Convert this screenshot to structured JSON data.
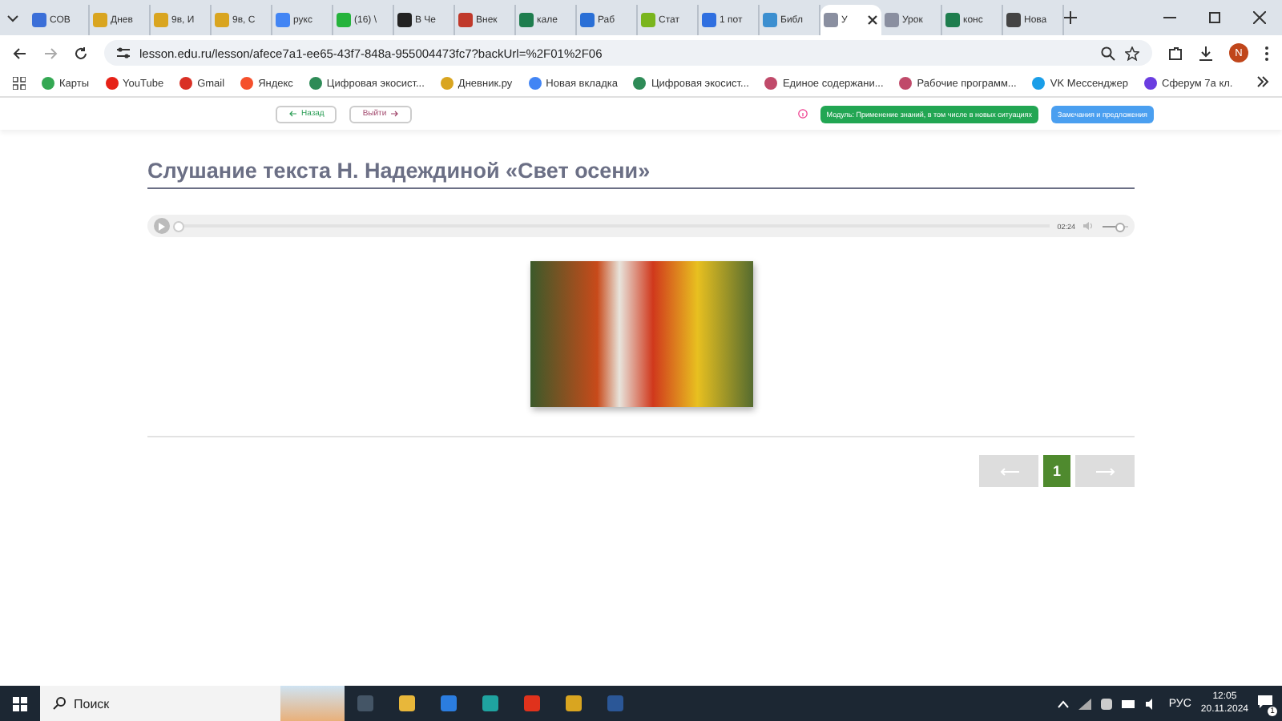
{
  "browser": {
    "tabs": [
      {
        "label": "СОВ",
        "selected": false,
        "color": "#3b6fd8"
      },
      {
        "label": "Днев",
        "selected": false,
        "color": "#d9a520"
      },
      {
        "label": "9в, И",
        "selected": false,
        "color": "#d9a520"
      },
      {
        "label": "9в, С",
        "selected": false,
        "color": "#d9a520"
      },
      {
        "label": "рукс",
        "selected": false,
        "color": "#4285f4"
      },
      {
        "label": "(16) \\",
        "selected": false,
        "color": "#25b33c"
      },
      {
        "label": "В Че",
        "selected": false,
        "color": "#222222"
      },
      {
        "label": "Внек",
        "selected": false,
        "color": "#c0392b"
      },
      {
        "label": "кале",
        "selected": false,
        "color": "#1e7d4e"
      },
      {
        "label": "Раб",
        "selected": false,
        "color": "#2a6fd6"
      },
      {
        "label": "Стат",
        "selected": false,
        "color": "#7ab51d"
      },
      {
        "label": "1 пот",
        "selected": false,
        "color": "#2f6fe0"
      },
      {
        "label": "Библ",
        "selected": false,
        "color": "#3c8fd0"
      },
      {
        "label": "У",
        "selected": true,
        "color": "#8a8fa0"
      },
      {
        "label": "Урок",
        "selected": false,
        "color": "#8a8fa0"
      },
      {
        "label": "конс",
        "selected": false,
        "color": "#1e7d4e"
      },
      {
        "label": "Нова",
        "selected": false,
        "color": "#444444"
      }
    ],
    "url": "lesson.edu.ru/lesson/afece7a1-ee65-43f7-848a-955004473fc7?backUrl=%2F01%2F06",
    "profile_initial": "N",
    "bookmarks": [
      {
        "label": "Карты",
        "color": "#34a853"
      },
      {
        "label": "YouTube",
        "color": "#e62117"
      },
      {
        "label": "Gmail",
        "color": "#d93025"
      },
      {
        "label": "Яндекс",
        "color": "#f5502c"
      },
      {
        "label": "Цифровая экосист...",
        "color": "#2e8b57"
      },
      {
        "label": "Дневник.ру",
        "color": "#d9a520"
      },
      {
        "label": "Новая вкладка",
        "color": "#4285f4"
      },
      {
        "label": "Цифровая экосист...",
        "color": "#2e8b57"
      },
      {
        "label": "Единое содержани...",
        "color": "#c04a6a"
      },
      {
        "label": "Рабочие программ...",
        "color": "#c04a6a"
      },
      {
        "label": "VK Мессенджер",
        "color": "#1a9ee8"
      },
      {
        "label": "Сферум 7а кл.",
        "color": "#6a3de0"
      }
    ]
  },
  "page": {
    "back_button": "Назад",
    "exit_button": "Выйти",
    "module_pill": "Модуль: Применение знаний, в том числе в новых ситуациях",
    "feedback_button": "Замечания и предложения",
    "title": "Слушание текста Н. Надеждиной «Свет осени»",
    "audio": {
      "time": "02:24",
      "level": 0,
      "volume": {
        "level": 0.6
      }
    },
    "pages": [
      {
        "label": "1",
        "selected": true
      }
    ]
  },
  "taskbar": {
    "search": {
      "placeholder": "Поиск"
    },
    "language": "РУС",
    "time": "12:05",
    "date": "20.11.2024",
    "notifications": "1"
  }
}
